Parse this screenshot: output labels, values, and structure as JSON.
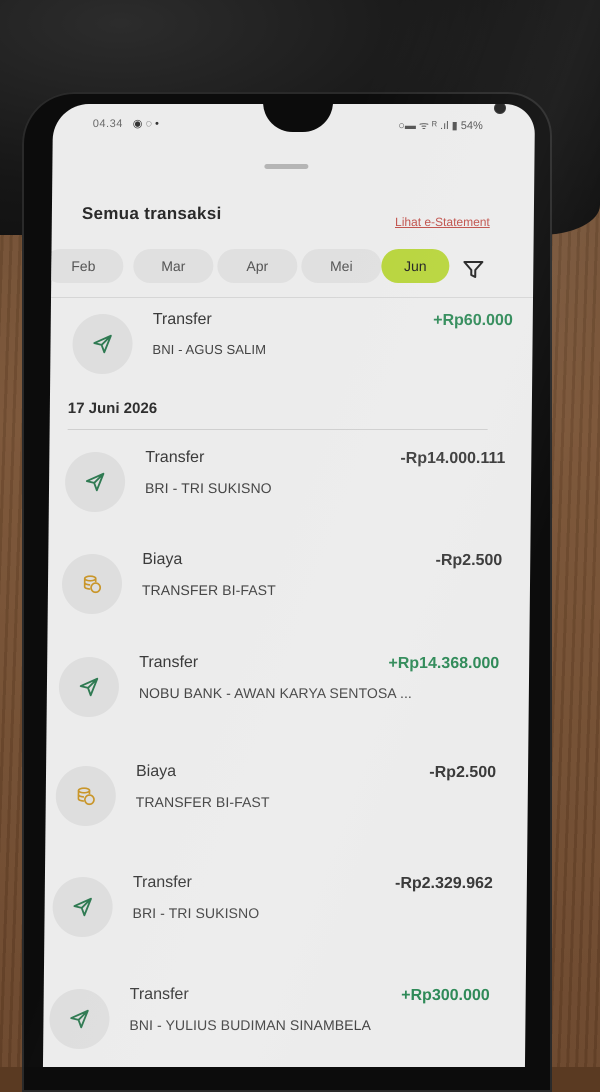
{
  "status": {
    "time": "04.34",
    "notifications": "◉ ◌ •",
    "right": "○▬ ᯤ ᴿ .ıl ▮ 54%"
  },
  "sheet": {
    "title": "Semua transaksi",
    "estatement_link": "Lihat e-Statement"
  },
  "months": [
    {
      "label": "Feb",
      "active": false
    },
    {
      "label": "Mar",
      "active": false
    },
    {
      "label": "Apr",
      "active": false
    },
    {
      "label": "Mei",
      "active": false
    },
    {
      "label": "Jun",
      "active": true
    }
  ],
  "filter_icon": "filter-icon",
  "first_transaction": {
    "title": "Transfer",
    "description": "BNI - AGUS SALIM",
    "amount": "+Rp60.000",
    "icon": "send-icon",
    "positive": true
  },
  "date_group": {
    "date": "17 Juni 2026",
    "transactions": [
      {
        "title": "Transfer",
        "description": "BRI - TRI SUKISNO",
        "amount": "-Rp14.000.111",
        "icon": "send-icon",
        "positive": false
      },
      {
        "title": "Biaya",
        "description": "TRANSFER BI-FAST",
        "amount": "-Rp2.500",
        "icon": "fee-coins-icon",
        "positive": false
      },
      {
        "title": "Transfer",
        "description": "NOBU BANK - AWAN KARYA SENTOSA ...",
        "amount": "+Rp14.368.000",
        "icon": "send-icon",
        "positive": true
      },
      {
        "title": "Biaya",
        "description": "TRANSFER BI-FAST",
        "amount": "-Rp2.500",
        "icon": "fee-coins-icon",
        "positive": false
      },
      {
        "title": "Transfer",
        "description": "BRI - TRI SUKISNO",
        "amount": "-Rp2.329.962",
        "icon": "send-icon",
        "positive": false
      },
      {
        "title": "Transfer",
        "description": "BNI - YULIUS BUDIMAN SINAMBELA",
        "amount": "+Rp300.000",
        "icon": "send-icon",
        "positive": true
      }
    ]
  },
  "colors": {
    "accent_chip": "#b8d53c",
    "positive_amount": "#2f8a58",
    "link": "#c0504a",
    "icon_green": "#2f7a52",
    "fee_icon": "#c9962a"
  }
}
